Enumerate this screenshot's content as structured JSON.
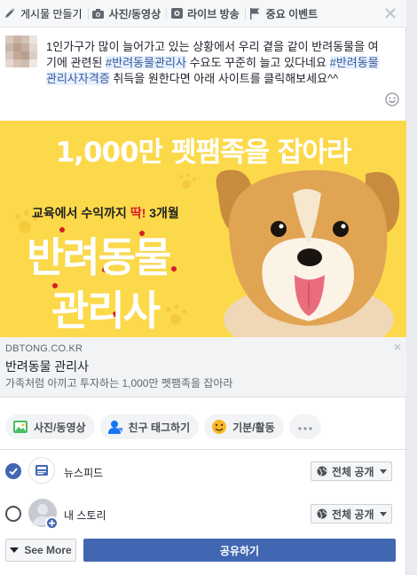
{
  "tabs": [
    {
      "label": "게시물 만들기",
      "icon": "pencil-icon"
    },
    {
      "label": "사진/동영상",
      "icon": "camera-icon"
    },
    {
      "label": "라이브 방송",
      "icon": "video-camera-icon"
    },
    {
      "label": "중요 이벤트",
      "icon": "flag-icon"
    }
  ],
  "post": {
    "text_1": "1인가구가 많이 늘어가고 있는 상황에서 우리 곁을 같이 반려동물을 여기에 관련된 ",
    "hashtag_1": "#반려동물관리사",
    "text_2": " 수요도 꾸준히 늘고 있다네요 ",
    "hashtag_2": "#반려동물관리사자격증",
    "text_3": " 취득을 원한다면 아래 사이트를 클릭해보세요^^"
  },
  "ad": {
    "headline": "1,000만 펫팸족을 잡아라",
    "sub_prefix": "교육에서 수익까지 ",
    "sub_emph": "딱!",
    "sub_suffix": " 3개월",
    "title_line1": "반려동물",
    "title_line2": "관리사"
  },
  "link": {
    "domain": "DBTONG.CO.KR",
    "title": "반려동물 관리사",
    "description": "가족처럼 아끼고 투자하는 1,000만 펫팸족을 잡아라"
  },
  "chips": [
    {
      "label": "사진/동영상",
      "icon": "photo-icon"
    },
    {
      "label": "친구 태그하기",
      "icon": "tag-friend-icon"
    },
    {
      "label": "기분/활동",
      "icon": "smiley-icon"
    }
  ],
  "share_rows": [
    {
      "label": "뉴스피드",
      "privacy": "전체 공개",
      "checked": true
    },
    {
      "label": "내 스토리",
      "privacy": "전체 공개",
      "checked": false
    }
  ],
  "footer": {
    "see_more": "See More",
    "share": "공유하기"
  },
  "colors": {
    "brand": "#4267b2",
    "ad_background": "#fcd94a",
    "hashtag_bg": "#e7f0fe"
  }
}
